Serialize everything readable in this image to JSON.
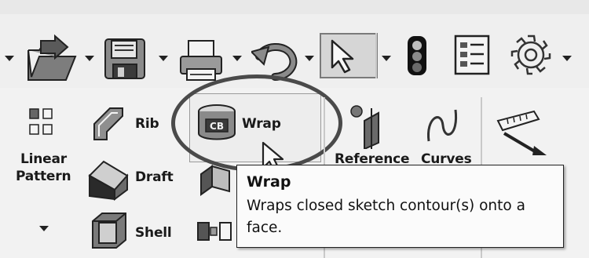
{
  "toolbar": {
    "items": [
      {
        "name": "open-icon"
      },
      {
        "name": "save-icon"
      },
      {
        "name": "print-icon"
      },
      {
        "name": "undo-icon"
      },
      {
        "name": "select-arrow-icon"
      },
      {
        "name": "traffic-light-icon"
      },
      {
        "name": "options-list-icon"
      },
      {
        "name": "gear-icon"
      }
    ]
  },
  "ribbon": {
    "linear_pattern_line1": "Linear",
    "linear_pattern_line2": "Pattern",
    "rib": "Rib",
    "draft": "Draft",
    "shell": "Shell",
    "wrap": "Wrap",
    "reference": "Reference",
    "curves": "Curves"
  },
  "tooltip": {
    "title": "Wrap",
    "body": "Wraps closed sketch contour(s) onto a face."
  }
}
